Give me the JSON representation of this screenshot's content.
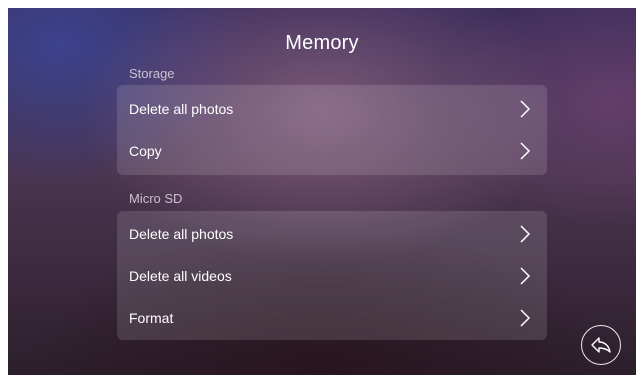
{
  "header": {
    "title": "Memory"
  },
  "storage": {
    "label": "Storage",
    "items": [
      {
        "label": "Delete all photos",
        "icon": "chevron-right-icon"
      },
      {
        "label": "Copy",
        "icon": "chevron-right-icon"
      }
    ]
  },
  "microsd": {
    "label": "Micro SD",
    "items": [
      {
        "label": "Delete all photos",
        "icon": "chevron-right-icon"
      },
      {
        "label": "Delete all videos",
        "icon": "chevron-right-icon"
      },
      {
        "label": "Format",
        "icon": "chevron-right-icon"
      }
    ]
  },
  "footer": {
    "back_icon": "back-arrow-icon"
  }
}
